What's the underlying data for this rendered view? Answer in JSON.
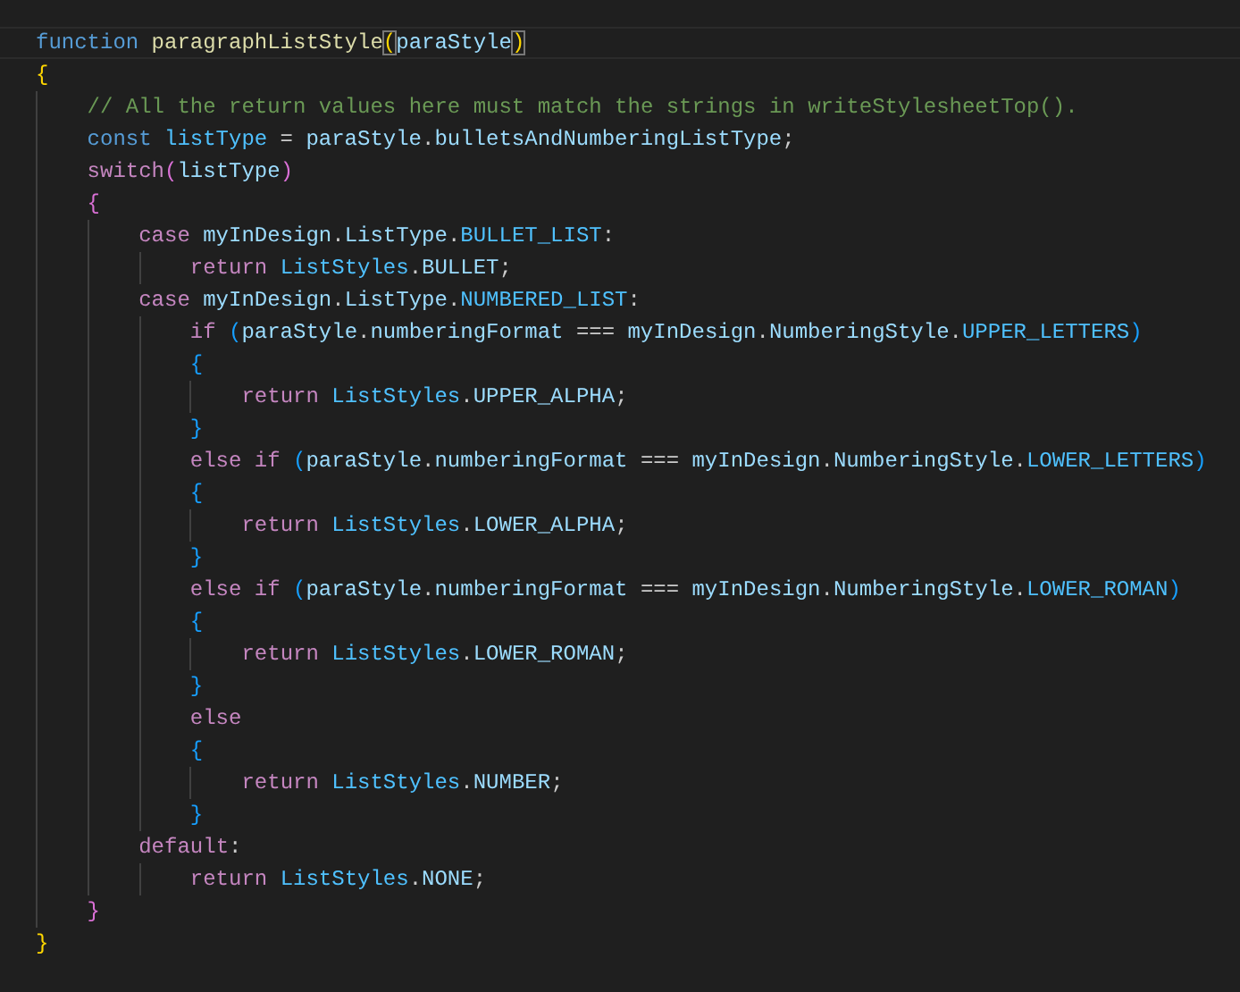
{
  "editor": {
    "lines": [
      {
        "current": true,
        "tokens": [
          {
            "kind": "kw",
            "text": "function"
          },
          {
            "kind": "fn",
            "text": "paragraphListStyle",
            "gap": true
          },
          {
            "kind": "b1m",
            "text": "("
          },
          {
            "kind": "var",
            "text": "paraStyle"
          },
          {
            "kind": "b1m",
            "text": ")"
          }
        ]
      },
      {
        "current": false,
        "tokens": [
          {
            "kind": "b1",
            "text": "{"
          }
        ],
        "children": [
          {
            "current": false,
            "tokens": [
              {
                "kind": "cmt",
                "text": "// All the return values here must match the strings in writeStylesheetTop()."
              }
            ]
          },
          {
            "current": false,
            "tokens": [
              {
                "kind": "kw",
                "text": "const"
              },
              {
                "kind": "cst",
                "text": "listType",
                "gap": true
              },
              {
                "kind": "txt",
                "text": "=",
                "gap": true
              },
              {
                "kind": "var",
                "text": "paraStyle",
                "gap": true
              },
              {
                "kind": "txt",
                "text": "."
              },
              {
                "kind": "var",
                "text": "bulletsAndNumberingListType"
              },
              {
                "kind": "txt",
                "text": ";"
              }
            ]
          },
          {
            "current": false,
            "tokens": [
              {
                "kind": "ctl",
                "text": "switch"
              },
              {
                "kind": "b2",
                "text": "("
              },
              {
                "kind": "var",
                "text": "listType"
              },
              {
                "kind": "b2",
                "text": ")"
              }
            ]
          },
          {
            "current": false,
            "tokens": [
              {
                "kind": "b2",
                "text": "{"
              }
            ],
            "children": [
              {
                "current": false,
                "tokens": [
                  {
                    "kind": "ctl",
                    "text": "case"
                  },
                  {
                    "kind": "var",
                    "text": "myInDesign",
                    "gap": true
                  },
                  {
                    "kind": "txt",
                    "text": "."
                  },
                  {
                    "kind": "var",
                    "text": "ListType"
                  },
                  {
                    "kind": "txt",
                    "text": "."
                  },
                  {
                    "kind": "cst",
                    "text": "BULLET_LIST"
                  },
                  {
                    "kind": "txt",
                    "text": ":"
                  }
                ],
                "children": [
                  {
                    "current": false,
                    "tokens": [
                      {
                        "kind": "ctl",
                        "text": "return"
                      },
                      {
                        "kind": "cst",
                        "text": "ListStyles",
                        "gap": true
                      },
                      {
                        "kind": "txt",
                        "text": "."
                      },
                      {
                        "kind": "var",
                        "text": "BULLET"
                      },
                      {
                        "kind": "txt",
                        "text": ";"
                      }
                    ]
                  }
                ]
              },
              {
                "current": false,
                "tokens": [
                  {
                    "kind": "ctl",
                    "text": "case"
                  },
                  {
                    "kind": "var",
                    "text": "myInDesign",
                    "gap": true
                  },
                  {
                    "kind": "txt",
                    "text": "."
                  },
                  {
                    "kind": "var",
                    "text": "ListType"
                  },
                  {
                    "kind": "txt",
                    "text": "."
                  },
                  {
                    "kind": "cst",
                    "text": "NUMBERED_LIST"
                  },
                  {
                    "kind": "txt",
                    "text": ":"
                  }
                ],
                "children": [
                  {
                    "current": false,
                    "tokens": [
                      {
                        "kind": "ctl",
                        "text": "if"
                      },
                      {
                        "kind": "b3",
                        "text": "(",
                        "gap": true
                      },
                      {
                        "kind": "var",
                        "text": "paraStyle"
                      },
                      {
                        "kind": "txt",
                        "text": "."
                      },
                      {
                        "kind": "var",
                        "text": "numberingFormat"
                      },
                      {
                        "kind": "txt",
                        "text": "===",
                        "gap": true
                      },
                      {
                        "kind": "var",
                        "text": "myInDesign",
                        "gap": true
                      },
                      {
                        "kind": "txt",
                        "text": "."
                      },
                      {
                        "kind": "var",
                        "text": "NumberingStyle"
                      },
                      {
                        "kind": "txt",
                        "text": "."
                      },
                      {
                        "kind": "cst",
                        "text": "UPPER_LETTERS"
                      },
                      {
                        "kind": "b3",
                        "text": ")"
                      }
                    ]
                  },
                  {
                    "current": false,
                    "tokens": [
                      {
                        "kind": "b3",
                        "text": "{"
                      }
                    ],
                    "children": [
                      {
                        "current": false,
                        "tokens": [
                          {
                            "kind": "ctl",
                            "text": "return"
                          },
                          {
                            "kind": "cst",
                            "text": "ListStyles",
                            "gap": true
                          },
                          {
                            "kind": "txt",
                            "text": "."
                          },
                          {
                            "kind": "var",
                            "text": "UPPER_ALPHA"
                          },
                          {
                            "kind": "txt",
                            "text": ";"
                          }
                        ]
                      }
                    ]
                  },
                  {
                    "current": false,
                    "tokens": [
                      {
                        "kind": "b3",
                        "text": "}"
                      }
                    ]
                  },
                  {
                    "current": false,
                    "tokens": [
                      {
                        "kind": "ctl",
                        "text": "else"
                      },
                      {
                        "kind": "ctl",
                        "text": "if",
                        "gap": true
                      },
                      {
                        "kind": "b3",
                        "text": "(",
                        "gap": true
                      },
                      {
                        "kind": "var",
                        "text": "paraStyle"
                      },
                      {
                        "kind": "txt",
                        "text": "."
                      },
                      {
                        "kind": "var",
                        "text": "numberingFormat"
                      },
                      {
                        "kind": "txt",
                        "text": "===",
                        "gap": true
                      },
                      {
                        "kind": "var",
                        "text": "myInDesign",
                        "gap": true
                      },
                      {
                        "kind": "txt",
                        "text": "."
                      },
                      {
                        "kind": "var",
                        "text": "NumberingStyle"
                      },
                      {
                        "kind": "txt",
                        "text": "."
                      },
                      {
                        "kind": "cst",
                        "text": "LOWER_LETTERS"
                      },
                      {
                        "kind": "b3",
                        "text": ")"
                      }
                    ]
                  },
                  {
                    "current": false,
                    "tokens": [
                      {
                        "kind": "b3",
                        "text": "{"
                      }
                    ],
                    "children": [
                      {
                        "current": false,
                        "tokens": [
                          {
                            "kind": "ctl",
                            "text": "return"
                          },
                          {
                            "kind": "cst",
                            "text": "ListStyles",
                            "gap": true
                          },
                          {
                            "kind": "txt",
                            "text": "."
                          },
                          {
                            "kind": "var",
                            "text": "LOWER_ALPHA"
                          },
                          {
                            "kind": "txt",
                            "text": ";"
                          }
                        ]
                      }
                    ]
                  },
                  {
                    "current": false,
                    "tokens": [
                      {
                        "kind": "b3",
                        "text": "}"
                      }
                    ]
                  },
                  {
                    "current": false,
                    "tokens": [
                      {
                        "kind": "ctl",
                        "text": "else"
                      },
                      {
                        "kind": "ctl",
                        "text": "if",
                        "gap": true
                      },
                      {
                        "kind": "b3",
                        "text": "(",
                        "gap": true
                      },
                      {
                        "kind": "var",
                        "text": "paraStyle"
                      },
                      {
                        "kind": "txt",
                        "text": "."
                      },
                      {
                        "kind": "var",
                        "text": "numberingFormat"
                      },
                      {
                        "kind": "txt",
                        "text": "===",
                        "gap": true
                      },
                      {
                        "kind": "var",
                        "text": "myInDesign",
                        "gap": true
                      },
                      {
                        "kind": "txt",
                        "text": "."
                      },
                      {
                        "kind": "var",
                        "text": "NumberingStyle"
                      },
                      {
                        "kind": "txt",
                        "text": "."
                      },
                      {
                        "kind": "cst",
                        "text": "LOWER_ROMAN"
                      },
                      {
                        "kind": "b3",
                        "text": ")"
                      }
                    ]
                  },
                  {
                    "current": false,
                    "tokens": [
                      {
                        "kind": "b3",
                        "text": "{"
                      }
                    ],
                    "children": [
                      {
                        "current": false,
                        "tokens": [
                          {
                            "kind": "ctl",
                            "text": "return"
                          },
                          {
                            "kind": "cst",
                            "text": "ListStyles",
                            "gap": true
                          },
                          {
                            "kind": "txt",
                            "text": "."
                          },
                          {
                            "kind": "var",
                            "text": "LOWER_ROMAN"
                          },
                          {
                            "kind": "txt",
                            "text": ";"
                          }
                        ]
                      }
                    ]
                  },
                  {
                    "current": false,
                    "tokens": [
                      {
                        "kind": "b3",
                        "text": "}"
                      }
                    ]
                  },
                  {
                    "current": false,
                    "tokens": [
                      {
                        "kind": "ctl",
                        "text": "else"
                      }
                    ]
                  },
                  {
                    "current": false,
                    "tokens": [
                      {
                        "kind": "b3",
                        "text": "{"
                      }
                    ],
                    "children": [
                      {
                        "current": false,
                        "tokens": [
                          {
                            "kind": "ctl",
                            "text": "return"
                          },
                          {
                            "kind": "cst",
                            "text": "ListStyles",
                            "gap": true
                          },
                          {
                            "kind": "txt",
                            "text": "."
                          },
                          {
                            "kind": "var",
                            "text": "NUMBER"
                          },
                          {
                            "kind": "txt",
                            "text": ";"
                          }
                        ]
                      }
                    ]
                  },
                  {
                    "current": false,
                    "tokens": [
                      {
                        "kind": "b3",
                        "text": "}"
                      }
                    ]
                  }
                ]
              },
              {
                "current": false,
                "tokens": [
                  {
                    "kind": "ctl",
                    "text": "default"
                  },
                  {
                    "kind": "txt",
                    "text": ":"
                  }
                ],
                "children": [
                  {
                    "current": false,
                    "tokens": [
                      {
                        "kind": "ctl",
                        "text": "return"
                      },
                      {
                        "kind": "cst",
                        "text": "ListStyles",
                        "gap": true
                      },
                      {
                        "kind": "txt",
                        "text": "."
                      },
                      {
                        "kind": "var",
                        "text": "NONE"
                      },
                      {
                        "kind": "txt",
                        "text": ";"
                      }
                    ]
                  }
                ]
              }
            ]
          },
          {
            "current": false,
            "tokens": [
              {
                "kind": "b2",
                "text": "}"
              }
            ]
          }
        ]
      },
      {
        "current": false,
        "tokens": [
          {
            "kind": "b1",
            "text": "}"
          }
        ]
      }
    ]
  }
}
